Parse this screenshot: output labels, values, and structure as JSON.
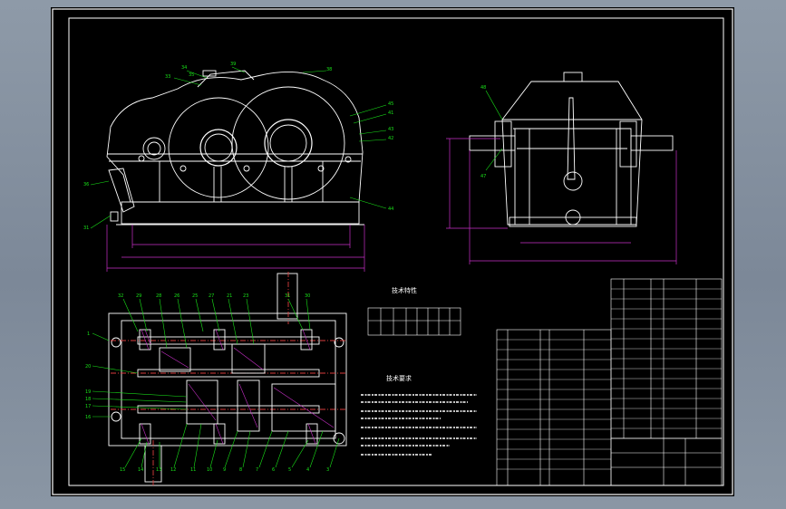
{
  "drawing": {
    "tech_char_title": "技术特性",
    "tech_req_title": "技术要求"
  },
  "colors": {
    "background": "#7f8b9a",
    "sheet": "#000000",
    "outline": "#ffffff",
    "leader": "#19e219",
    "dimension": "#c830c8",
    "centerline": "#d83c3c"
  }
}
